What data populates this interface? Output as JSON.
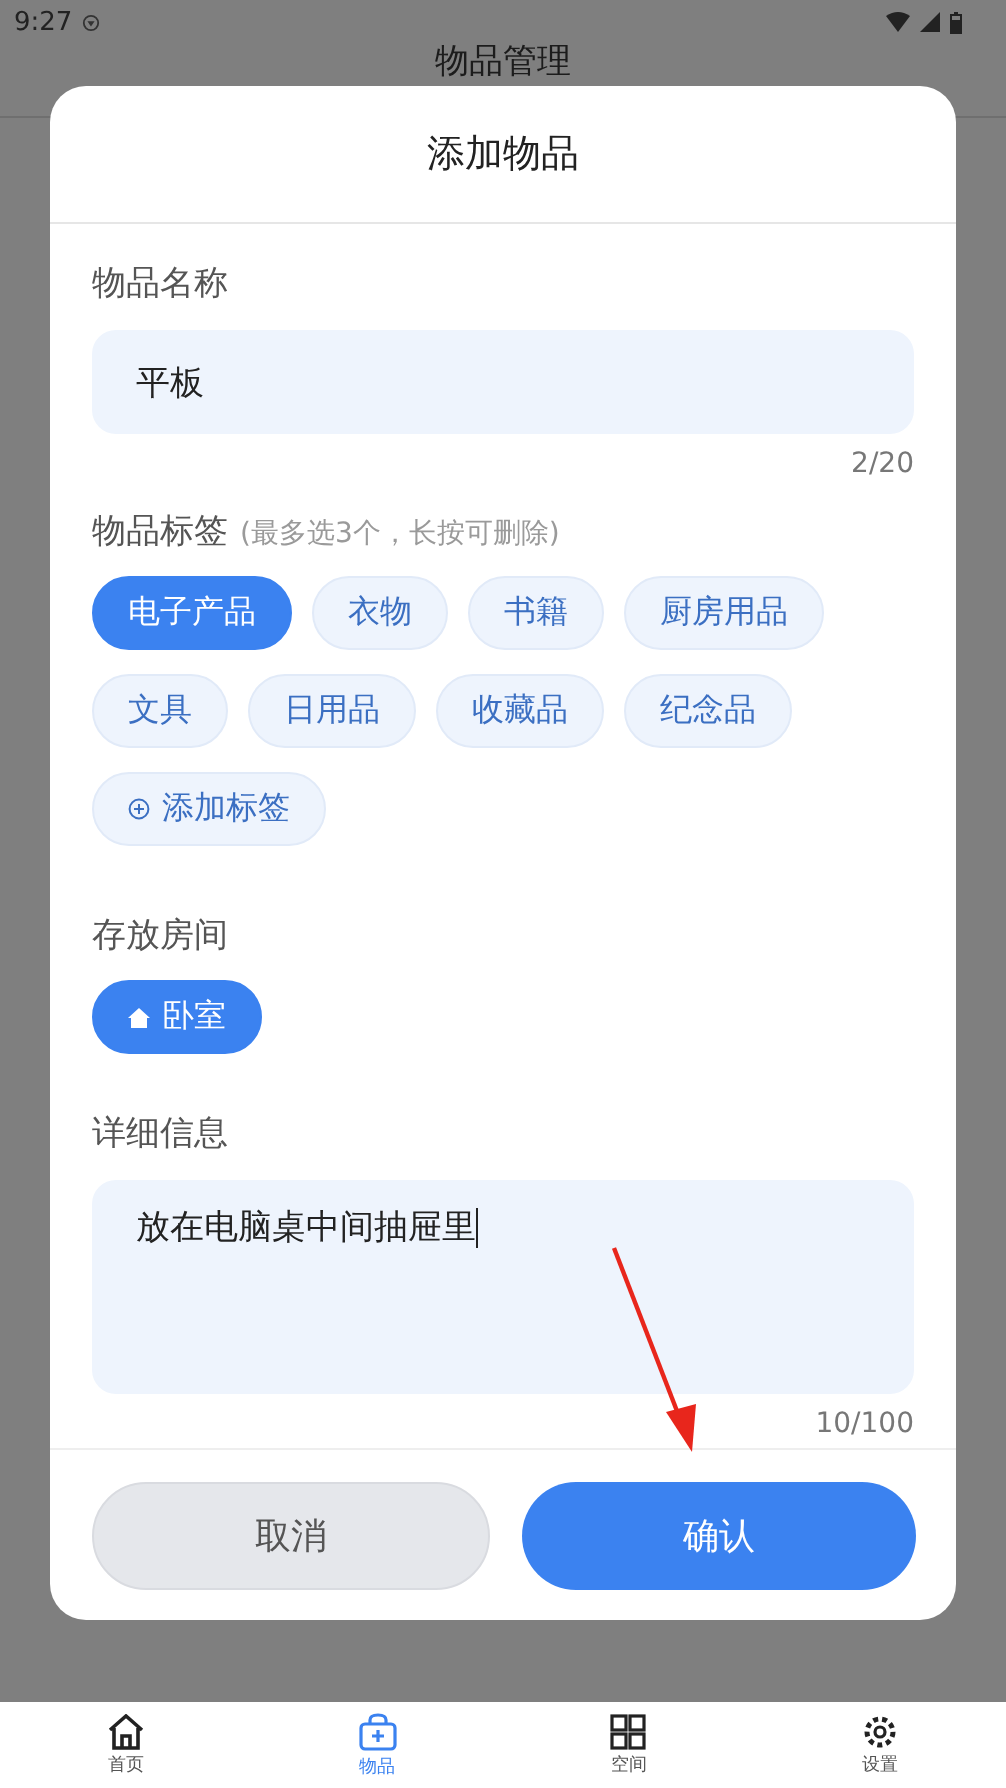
{
  "status_bar": {
    "time": "9:27"
  },
  "app_bar": {
    "title": "物品管理"
  },
  "dialog": {
    "title": "添加物品",
    "name_field": {
      "label": "物品名称",
      "value": "平板",
      "counter": "2/20"
    },
    "tags": {
      "label": "物品标签",
      "hint": "(最多选3个，长按可删除)",
      "items": [
        {
          "label": "电子产品",
          "selected": true
        },
        {
          "label": "衣物",
          "selected": false
        },
        {
          "label": "书籍",
          "selected": false
        },
        {
          "label": "厨房用品",
          "selected": false
        },
        {
          "label": "文具",
          "selected": false
        },
        {
          "label": "日用品",
          "selected": false
        },
        {
          "label": "收藏品",
          "selected": false
        },
        {
          "label": "纪念品",
          "selected": false
        }
      ],
      "add_button": "添加标签"
    },
    "room": {
      "label": "存放房间",
      "items": [
        {
          "label": "卧室",
          "selected": true
        }
      ]
    },
    "details": {
      "label": "详细信息",
      "value": "放在电脑桌中间抽屉里",
      "counter": "10/100"
    },
    "buttons": [
      {
        "label": "取消",
        "kind": "secondary"
      },
      {
        "label": "确认",
        "kind": "primary"
      }
    ]
  },
  "bottom_nav": [
    {
      "label": "首页",
      "kind": "home",
      "selected": false
    },
    {
      "label": "物品",
      "kind": "items",
      "selected": true
    },
    {
      "label": "空间",
      "kind": "space",
      "selected": false
    },
    {
      "label": "设置",
      "kind": "settings",
      "selected": false
    }
  ]
}
